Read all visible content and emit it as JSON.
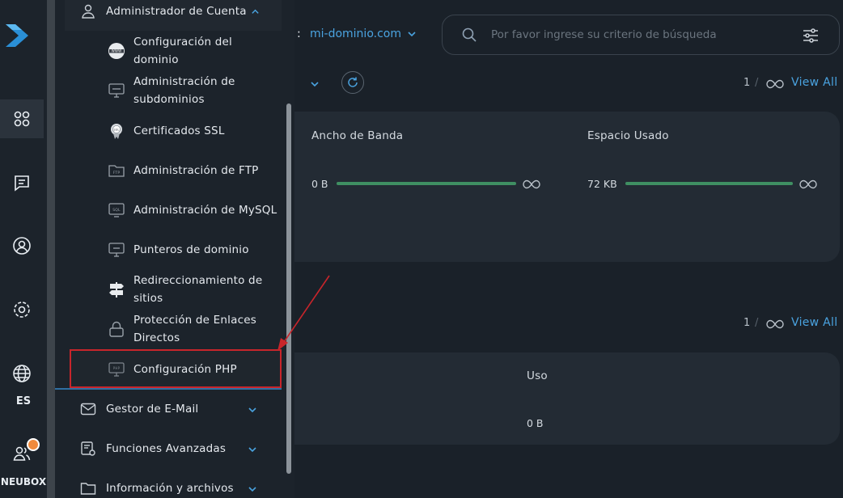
{
  "sidebar": {
    "lang": "ES",
    "user_label": "NEUBOX"
  },
  "submenu": {
    "header_label": "Administrador de Cuenta",
    "items": [
      {
        "label_lines": [
          "Configuración del",
          "dominio"
        ],
        "icon": "www-globe-icon"
      },
      {
        "label_lines": [
          "Administración de",
          "subdominios"
        ],
        "icon": "monitor-icon"
      },
      {
        "label_lines": [
          "Certificados SSL"
        ],
        "icon": "ssl-badge-icon"
      },
      {
        "label_lines": [
          "Administración de FTP"
        ],
        "icon": "ftp-folder-icon"
      },
      {
        "label_lines": [
          "Administración de MySQL"
        ],
        "icon": "sql-monitor-icon"
      },
      {
        "label_lines": [
          "Punteros de dominio"
        ],
        "icon": "monitor-icon"
      },
      {
        "label_lines": [
          "Redireccionamiento de",
          "sitios"
        ],
        "icon": "signpost-icon"
      },
      {
        "label_lines": [
          "Protección de Enlaces",
          "Directos"
        ],
        "icon": "lock-icon"
      },
      {
        "label_lines": [
          "Configuración PHP"
        ],
        "icon": "php-monitor-icon"
      }
    ],
    "sections": [
      {
        "label": "Gestor de E-Mail",
        "icon": "mail-icon"
      },
      {
        "label": "Funciones Avanzadas",
        "icon": "advanced-gear-icon"
      },
      {
        "label": "Información y archivos",
        "icon": "folder-icon"
      }
    ]
  },
  "main": {
    "domain_colon": ":",
    "domain": "mi-dominio.com",
    "search_placeholder": "Por favor ingrese su criterio de búsqueda",
    "section1": {
      "count": "1",
      "slash": "/",
      "view_all": "View All"
    },
    "section2": {
      "count": "1",
      "slash": "/",
      "view_all": "View All"
    },
    "bandwidth": {
      "label": "Ancho de Banda",
      "value": "0 B",
      "fill": 1.0
    },
    "space": {
      "label": "Espacio Usado",
      "value": "72 KB",
      "fill": 1.0
    },
    "usage": {
      "label": "Uso",
      "value": "0 B"
    }
  },
  "colors": {
    "background": "#1a2129",
    "accent": "#4aa3e0",
    "progress": "#3f8f62",
    "highlight_box": "#c8252b",
    "notification": "#f08a3c"
  }
}
